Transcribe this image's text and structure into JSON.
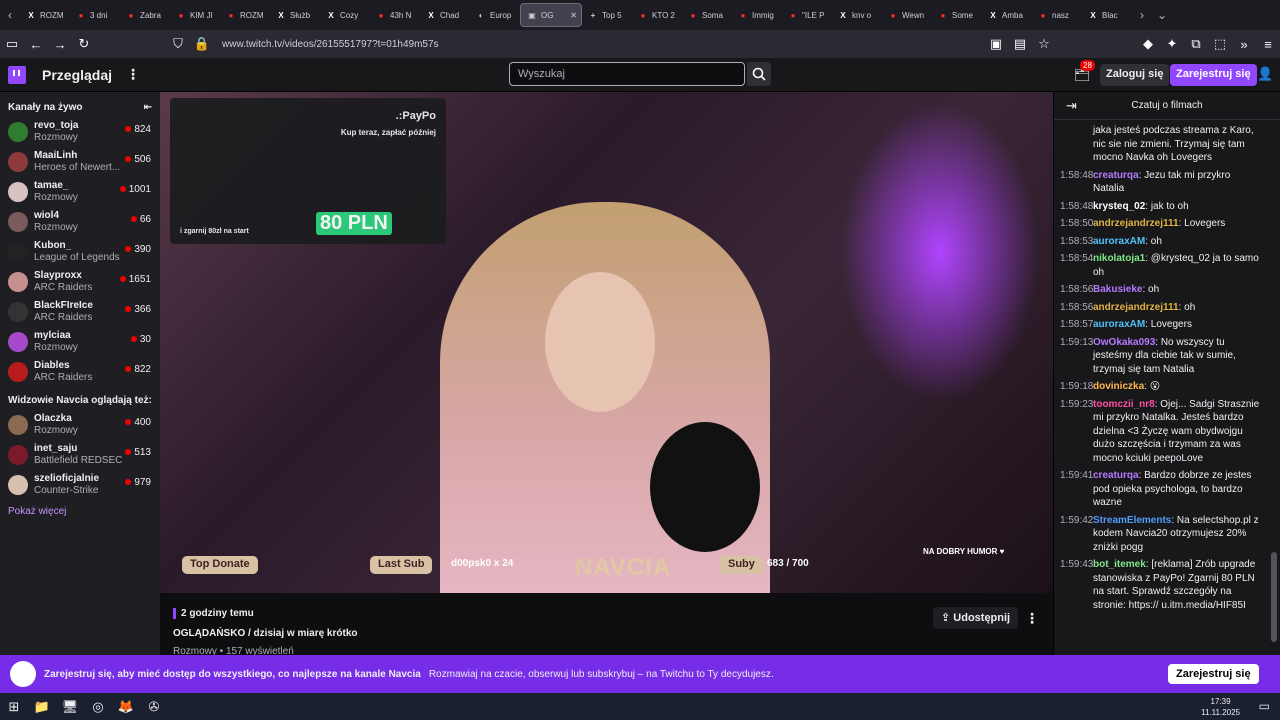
{
  "browser": {
    "tabs": [
      {
        "label": "ROZM",
        "fav": "X"
      },
      {
        "label": "3 dni",
        "fav": "●"
      },
      {
        "label": "Zabra",
        "fav": "●"
      },
      {
        "label": "KIM JI",
        "fav": "●"
      },
      {
        "label": "ROZM",
        "fav": "●"
      },
      {
        "label": "Służb",
        "fav": "X"
      },
      {
        "label": "Cozy",
        "fav": "X"
      },
      {
        "label": "43h N",
        "fav": "●"
      },
      {
        "label": "Chad",
        "fav": "X"
      },
      {
        "label": "Europ",
        "fav": "◐"
      },
      {
        "label": "OG",
        "fav": "▣",
        "active": true
      },
      {
        "label": "Top 5",
        "fav": "+"
      },
      {
        "label": "KTO 2",
        "fav": "●"
      },
      {
        "label": "Soma",
        "fav": "●"
      },
      {
        "label": "Immig",
        "fav": "●"
      },
      {
        "label": "\"ILE P",
        "fav": "●"
      },
      {
        "label": "knv o",
        "fav": "X"
      },
      {
        "label": "Wewn",
        "fav": "●"
      },
      {
        "label": "Some",
        "fav": "●"
      },
      {
        "label": "Amba",
        "fav": "X"
      },
      {
        "label": "nasz",
        "fav": "●"
      },
      {
        "label": "Blac",
        "fav": "X"
      }
    ],
    "url": "www.twitch.tv/videos/2615551797?t=01h49m57s"
  },
  "header": {
    "browse": "Przeglądaj",
    "search_placeholder": "Wyszukaj",
    "notifications": "28",
    "login": "Zaloguj się",
    "register": "Zarejestruj się"
  },
  "sidebar": {
    "live_title": "Kanały na żywo",
    "live": [
      {
        "name": "revo_toja",
        "game": "Rozmowy",
        "viewers": "824",
        "color": "#2e7d32"
      },
      {
        "name": "MaaiLinh",
        "game": "Heroes of Newert...",
        "viewers": "506",
        "color": "#8d3a3a"
      },
      {
        "name": "tamae_",
        "game": "Rozmowy",
        "viewers": "1001",
        "color": "#d9c2c2"
      },
      {
        "name": "wiol4",
        "game": "Rozmowy",
        "viewers": "66",
        "color": "#7a5a5a"
      },
      {
        "name": "Kubon_",
        "game": "League of Legends",
        "viewers": "390",
        "color": "#222"
      },
      {
        "name": "Slayproxx",
        "game": "ARC Raiders",
        "viewers": "1651",
        "color": "#c79090"
      },
      {
        "name": "BlackFIreIce",
        "game": "ARC Raiders",
        "viewers": "366",
        "color": "#333"
      },
      {
        "name": "mylciaa",
        "game": "Rozmowy",
        "viewers": "30",
        "color": "#a64ac9"
      },
      {
        "name": "Diables",
        "game": "ARC Raiders",
        "viewers": "822",
        "color": "#b71c1c"
      }
    ],
    "also_title": "Widzowie Navcia oglądają też:",
    "also": [
      {
        "name": "Olaczka",
        "game": "Rozmowy",
        "viewers": "400",
        "color": "#8a6a50"
      },
      {
        "name": "inet_saju",
        "game": "Battlefield REDSEC",
        "viewers": "513",
        "color": "#7a1a2a"
      },
      {
        "name": "szelioficjalnie",
        "game": "Counter-Strike",
        "viewers": "979",
        "color": "#d8c0b0"
      }
    ],
    "show_more": "Pokaż więcej"
  },
  "video": {
    "ad_brand": ".:PayPo",
    "ad_sub": "Kup teraz, zapłać później",
    "ad_amount": "80 PLN",
    "ad_cta": "i zgarnij 80zł na start",
    "top_donate": "Top Donate",
    "last_sub": "Last Sub",
    "last_sub_value": "d00psk0 x 24",
    "channel_logo": "NAVCIA",
    "subs_label": "Suby",
    "subs_value": "683 / 700",
    "mood": "NA DOBRY HUMOR ♥"
  },
  "info": {
    "ago": "2 godziny temu",
    "title": "OGLĄDAŃSKO / dzisiaj w miarę krótko",
    "meta": "Rozmowy • 157 wyświetleń",
    "share": "Udostępnij"
  },
  "chat": {
    "title": "Czatuj o filmach",
    "messages": [
      {
        "time": "",
        "user": "",
        "color": "#fff",
        "text": "jaka jesteś podczas streama z Karo, nic sie nie zmieni. Trzymaj się tam mocno Navka oh Lovegers"
      },
      {
        "time": "1:58:48",
        "user": "creaturqa",
        "color": "#b57aff",
        "text": ": Jezu tak mi przykro Natalia"
      },
      {
        "time": "1:58:48",
        "user": "krysteq_02",
        "color": "#ffffff",
        "text": ": jak to oh"
      },
      {
        "time": "1:58:50",
        "user": "andrzejandrzej111",
        "color": "#e0b341",
        "text": ": Lovegers"
      },
      {
        "time": "1:58:53",
        "user": "auroraxAM",
        "color": "#4fc3f7",
        "text": ": oh"
      },
      {
        "time": "1:58:54",
        "user": "nikolatoja1",
        "color": "#7ee787",
        "text": ": @krysteq_02 ja to samo oh"
      },
      {
        "time": "1:58:56",
        "user": "Bakusieke",
        "color": "#b57aff",
        "text": ": oh"
      },
      {
        "time": "1:58:56",
        "user": "andrzejandrzej111",
        "color": "#e0b341",
        "text": ": oh"
      },
      {
        "time": "1:58:57",
        "user": "auroraxAM",
        "color": "#4fc3f7",
        "text": ": Lovegers"
      },
      {
        "time": "1:59:13",
        "user": "OwOkaka093",
        "color": "#b57aff",
        "text": ": No wszyscy tu jesteśmy dla ciebie tak w sumie, trzymaj się tam Natalia"
      },
      {
        "time": "1:59:18",
        "user": "doviniczka",
        "color": "#ffb74d",
        "text": ": 😮"
      },
      {
        "time": "1:59:23",
        "user": "toomczii_nr8",
        "color": "#ff4fa3",
        "text": ": Ojej... Sadgi Strasznie mi przykro Natalka. Jesteś bardzo dzielna <3 Życzę wam obydwojgu dużo szczęścia i trzymam za was mocno kciuki peepoLove"
      },
      {
        "time": "1:59:41",
        "user": "creaturqa",
        "color": "#b57aff",
        "text": ": Bardzo dobrze ze jestes pod opieka psychologa, to bardzo wazne"
      },
      {
        "time": "1:59:42",
        "user": "StreamElements",
        "color": "#4f9cf7",
        "text": ": Na selectshop.pl z kodem Navcia20 otrzymujesz 20% zniżki pogg"
      },
      {
        "time": "1:59:43",
        "user": "bot_itemek",
        "color": "#7ee787",
        "text": ": [reklama] Zrób upgrade stanowiska z PayPo! Zgarnij 80 PLN na start. Sprawdź szczegóły na stronie: https:// u.itm.media/HIF85I"
      }
    ]
  },
  "promo": {
    "bold": "Zarejestruj się, aby mieć dostęp do wszystkiego, co najlepsze na kanale Navcia",
    "text": "Rozmawiaj na czacie, obserwuj lub subskrybuj – na Twitchu to Ty decydujesz.",
    "button": "Zarejestruj się"
  },
  "taskbar": {
    "time": "17:39",
    "date": "11.11.2025"
  }
}
